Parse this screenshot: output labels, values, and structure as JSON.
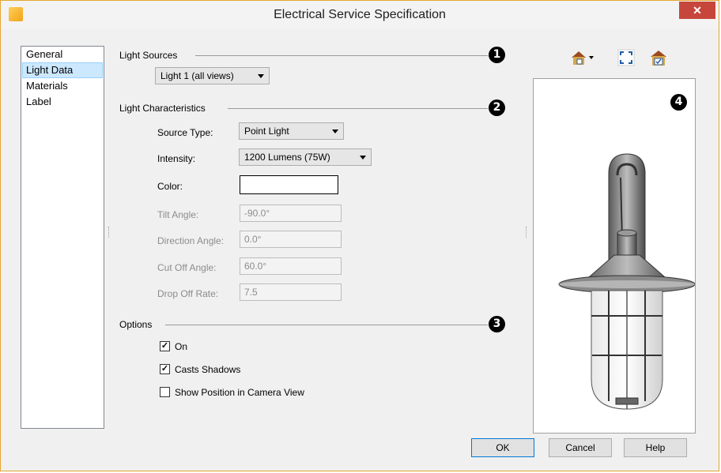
{
  "window": {
    "title": "Electrical Service Specification",
    "close_glyph": "✕"
  },
  "nav": {
    "items": [
      "General",
      "Light Data",
      "Materials",
      "Label"
    ],
    "selected": "Light Data"
  },
  "light_sources": {
    "label": "Light Sources",
    "selected": "Light 1 (all views)",
    "badge": "1"
  },
  "characteristics": {
    "label": "Light Characteristics",
    "badge": "2",
    "source_type_label": "Source Type:",
    "source_type_value": "Point Light",
    "intensity_label": "Intensity:",
    "intensity_value": "1200 Lumens (75W)",
    "color_label": "Color:",
    "color_value": "#ffffff",
    "tilt_label": "Tilt Angle:",
    "tilt_value": "-90.0°",
    "direction_label": "Direction Angle:",
    "direction_value": "0.0°",
    "cutoff_label": "Cut Off Angle:",
    "cutoff_value": "60.0°",
    "dropoff_label": "Drop Off Rate:",
    "dropoff_value": "7.5"
  },
  "options": {
    "label": "Options",
    "badge": "3",
    "items": [
      {
        "label": "On",
        "checked": true
      },
      {
        "label": "Casts Shadows",
        "checked": true
      },
      {
        "label": "Show Position in Camera View",
        "checked": false
      }
    ]
  },
  "preview": {
    "badge": "4",
    "tools": [
      "house-view-icon",
      "fit-view-icon",
      "layer-view-icon"
    ]
  },
  "buttons": {
    "ok": "OK",
    "cancel": "Cancel",
    "help": "Help"
  },
  "colors": {
    "accent": "#0078d7",
    "close": "#c7463c",
    "selection": "#cce8ff"
  }
}
